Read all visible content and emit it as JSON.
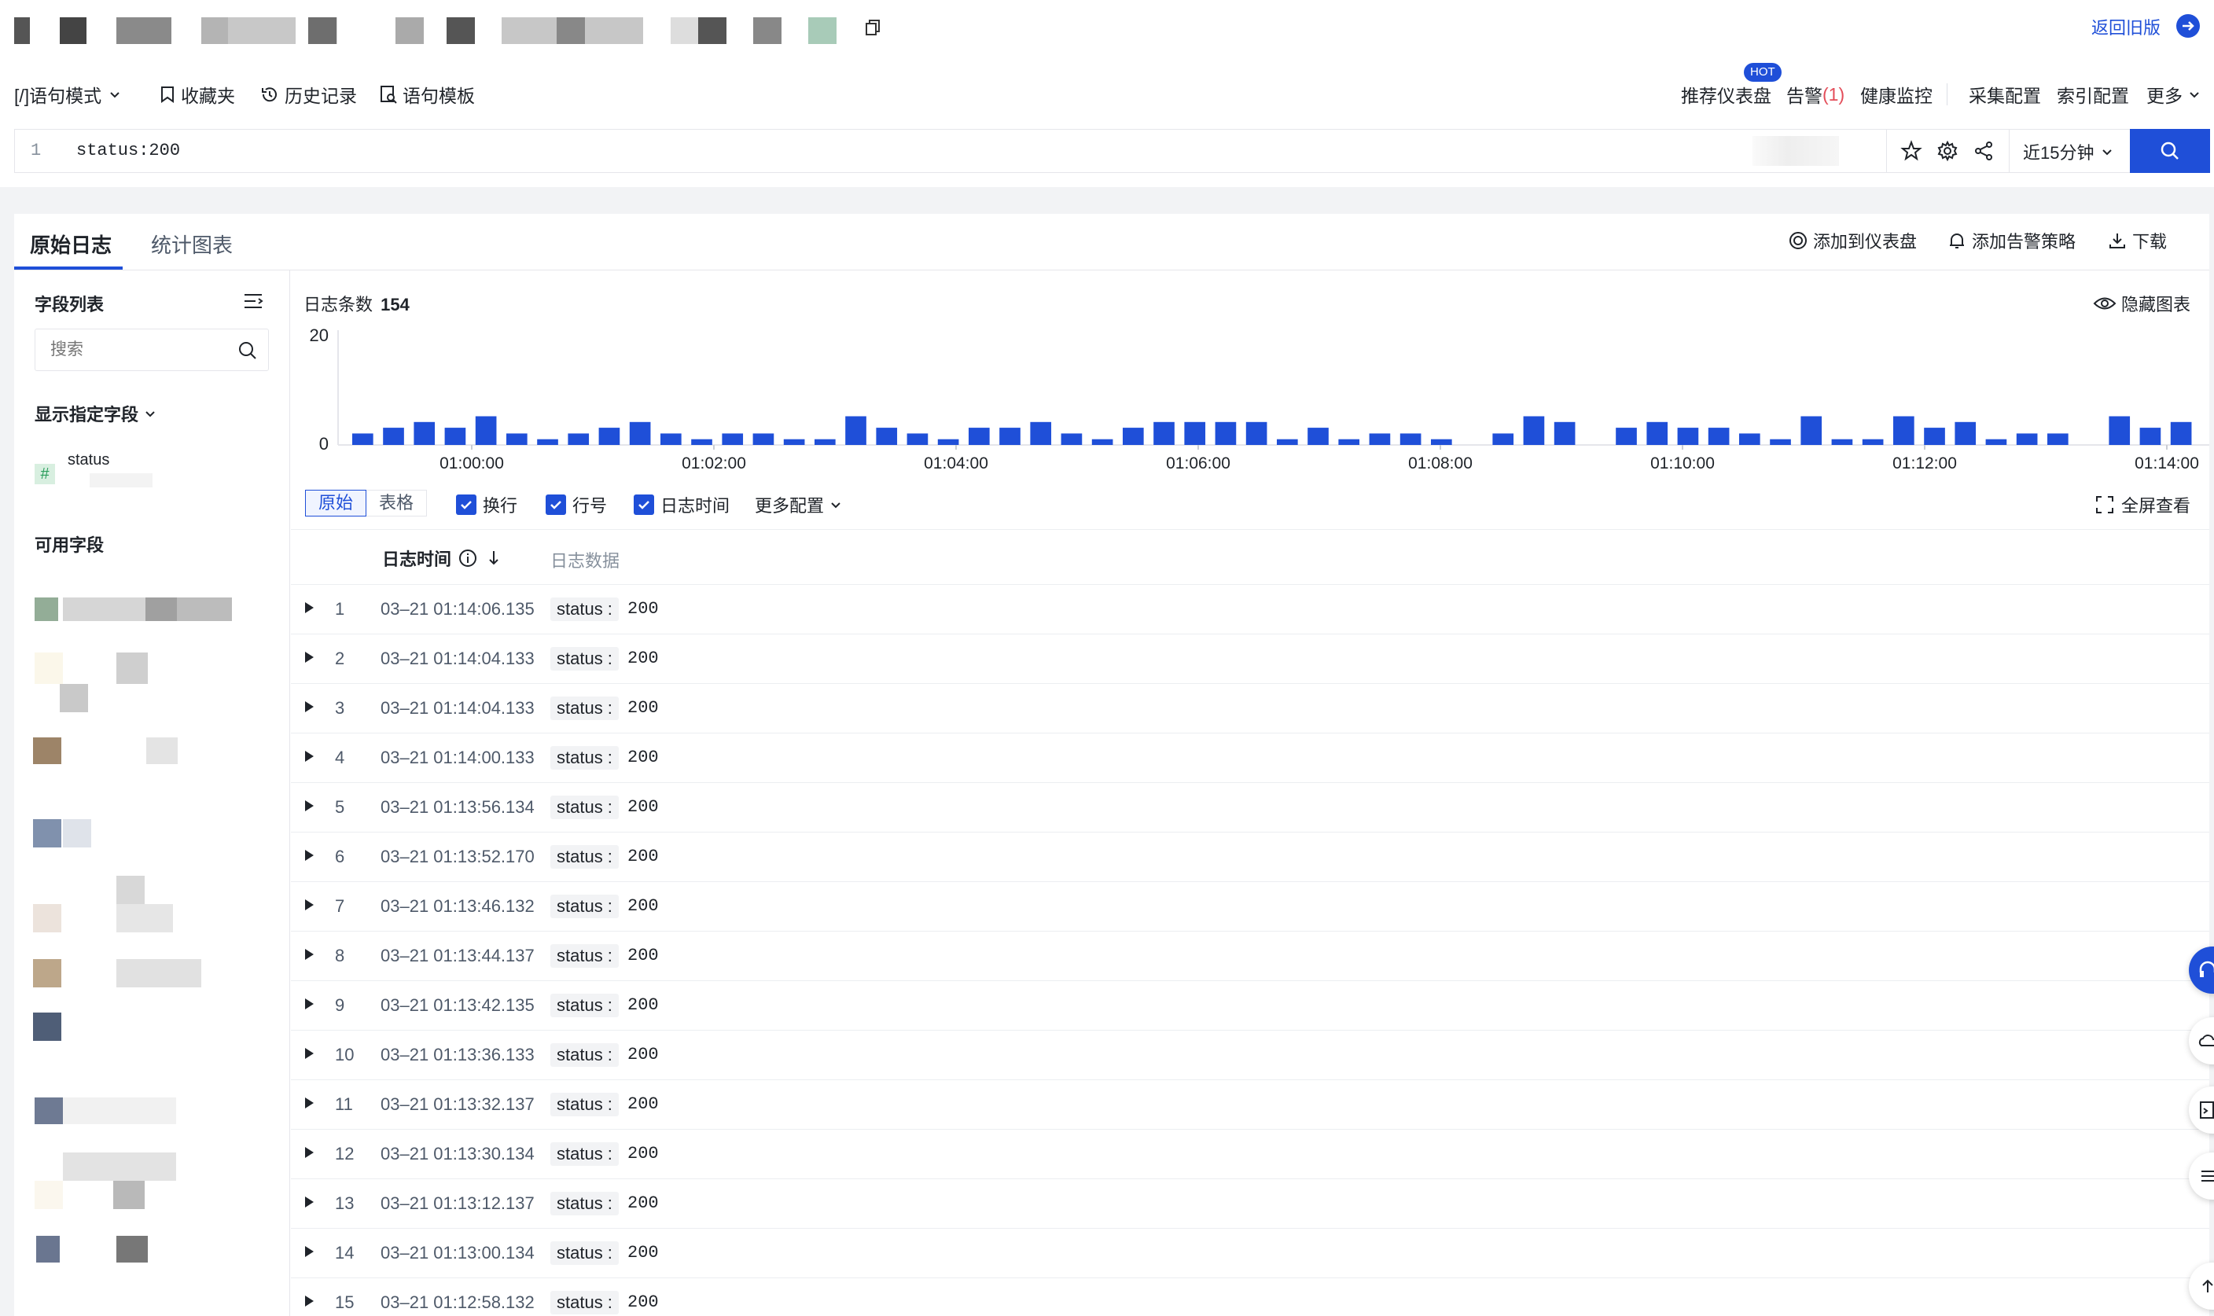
{
  "header": {
    "return_label": "返回旧版"
  },
  "toolbar": {
    "query_mode": "[/]语句模式",
    "favorites": "收藏夹",
    "history": "历史记录",
    "templates": "语句模板",
    "dashboard_rec": "推荐仪表盘",
    "hot_badge": "HOT",
    "alarm": "告警",
    "alarm_count": "(1)",
    "health": "健康监控",
    "collect_config": "采集配置",
    "index_config": "索引配置",
    "more": "更多"
  },
  "query": {
    "line_no": "1",
    "text": "status:200",
    "time_range": "近15分钟"
  },
  "tabs": {
    "raw": "原始日志",
    "stats": "统计图表",
    "add_dashboard": "添加到仪表盘",
    "add_alarm": "添加告警策略",
    "download": "下载"
  },
  "sidebar": {
    "title": "字段列表",
    "search_placeholder": "搜索",
    "shown_fields": "显示指定字段",
    "status_field": "status",
    "available": "可用字段"
  },
  "histogram": {
    "count_label": "日志条数",
    "count": "154",
    "hide_chart": "隐藏图表",
    "y_ticks": [
      "20",
      "0"
    ],
    "x_ticks": [
      "01:00:00",
      "01:02:00",
      "01:04:00",
      "01:06:00",
      "01:08:00",
      "01:10:00",
      "01:12:00",
      "01:14:00"
    ],
    "bar_color": "#1f4fd8",
    "counts": [
      2,
      3,
      4,
      3,
      5,
      2,
      1,
      2,
      3,
      4,
      2,
      1,
      2,
      2,
      1,
      1,
      5,
      3,
      2,
      1,
      3,
      3,
      4,
      2,
      1,
      3,
      4,
      4,
      4,
      4,
      1,
      3,
      1,
      2,
      2,
      1,
      0,
      2,
      5,
      4,
      0,
      3,
      4,
      3,
      3,
      2,
      1,
      5,
      1,
      1,
      5,
      3,
      4,
      1,
      2,
      2,
      0,
      5,
      3,
      4
    ]
  },
  "view": {
    "raw": "原始",
    "table": "表格",
    "wrap": "换行",
    "line_no": "行号",
    "log_time": "日志时间",
    "more_config": "更多配置",
    "fullscreen": "全屏查看"
  },
  "table": {
    "col_time": "日志时间",
    "col_data": "日志数据",
    "rows": [
      {
        "n": "1",
        "time": "03–21 01:14:06.135",
        "key": "status :",
        "val": "200"
      },
      {
        "n": "2",
        "time": "03–21 01:14:04.133",
        "key": "status :",
        "val": "200"
      },
      {
        "n": "3",
        "time": "03–21 01:14:04.133",
        "key": "status :",
        "val": "200"
      },
      {
        "n": "4",
        "time": "03–21 01:14:00.133",
        "key": "status :",
        "val": "200"
      },
      {
        "n": "5",
        "time": "03–21 01:13:56.134",
        "key": "status :",
        "val": "200"
      },
      {
        "n": "6",
        "time": "03–21 01:13:52.170",
        "key": "status :",
        "val": "200"
      },
      {
        "n": "7",
        "time": "03–21 01:13:46.132",
        "key": "status :",
        "val": "200"
      },
      {
        "n": "8",
        "time": "03–21 01:13:44.137",
        "key": "status :",
        "val": "200"
      },
      {
        "n": "9",
        "time": "03–21 01:13:42.135",
        "key": "status :",
        "val": "200"
      },
      {
        "n": "10",
        "time": "03–21 01:13:36.133",
        "key": "status :",
        "val": "200"
      },
      {
        "n": "11",
        "time": "03–21 01:13:32.137",
        "key": "status :",
        "val": "200"
      },
      {
        "n": "12",
        "time": "03–21 01:13:30.134",
        "key": "status :",
        "val": "200"
      },
      {
        "n": "13",
        "time": "03–21 01:13:12.137",
        "key": "status :",
        "val": "200"
      },
      {
        "n": "14",
        "time": "03–21 01:13:00.134",
        "key": "status :",
        "val": "200"
      },
      {
        "n": "15",
        "time": "03–21 01:12:58.132",
        "key": "status :",
        "val": "200"
      }
    ]
  }
}
